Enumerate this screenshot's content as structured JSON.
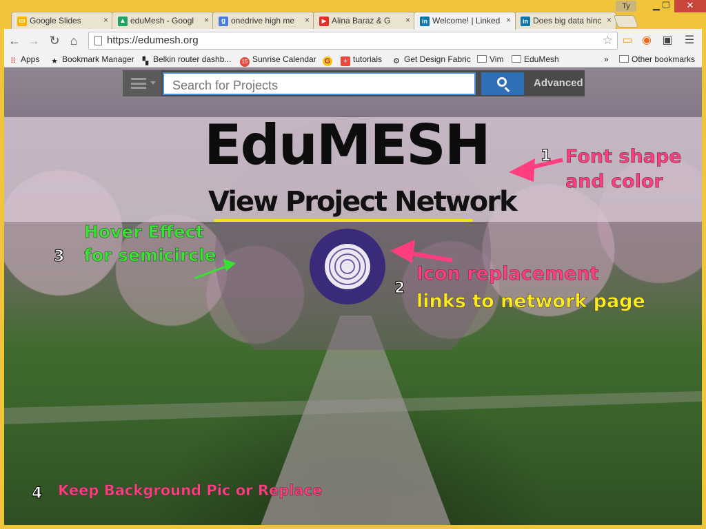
{
  "browser": {
    "tabs": [
      {
        "label": "Google Slides",
        "favicon": "slides-icon",
        "color": "#f4b400",
        "glyph": "▭"
      },
      {
        "label": "eduMesh - Googl",
        "favicon": "drive-icon",
        "color": "#1fa463",
        "glyph": "▲"
      },
      {
        "label": "onedrive high me",
        "favicon": "google-icon",
        "color": "#4a7bd8",
        "glyph": "g"
      },
      {
        "label": "Alina Baraz & G",
        "favicon": "youtube-icon",
        "color": "#e52d27",
        "glyph": "▶"
      },
      {
        "label": "Welcome! | Linked",
        "favicon": "linkedin-icon",
        "color": "#0e76a8",
        "glyph": "in"
      },
      {
        "label": "Does big data hinc",
        "favicon": "linkedin-icon",
        "color": "#0e76a8",
        "glyph": "in"
      }
    ],
    "close_glyph": "×",
    "user_badge": "Ty",
    "window_buttons": {
      "minimize": "▁",
      "maximize": "☐",
      "close": "✕"
    },
    "url": "https://edumesh.org",
    "bookmarks": [
      {
        "label": "Apps",
        "icon": "apps-grid-icon"
      },
      {
        "label": "Bookmark Manager",
        "icon": "star-icon"
      },
      {
        "label": "Belkin router dashb...",
        "icon": "belkin-icon"
      },
      {
        "label": "Sunrise Calendar",
        "icon": "sunrise-icon"
      },
      {
        "label": "",
        "icon": "g-circle-icon"
      },
      {
        "label": "tutorials",
        "icon": "plus-square-icon"
      },
      {
        "label": "Get Design Fabric",
        "icon": "gear-icon"
      },
      {
        "label": "Vim",
        "icon": "folder-icon"
      },
      {
        "label": "EduMesh",
        "icon": "folder-icon"
      }
    ],
    "bookmarks_overflow": "»",
    "other_bookmarks": "Other bookmarks"
  },
  "site": {
    "search_placeholder": "Search for Projects",
    "advanced_label": "Advanced",
    "brand": "EduMESH",
    "subtitle": "View Project Network",
    "accent_colors": {
      "underline": "#f4e21c",
      "icon_ring": "#3a2a7a",
      "search_button": "#2f6fb5"
    }
  },
  "annotations": [
    {
      "number": "1",
      "lines": [
        "Font shape",
        "and color"
      ],
      "color": "pink"
    },
    {
      "number": "2",
      "lines": [
        "Icon replacement",
        "links to network page"
      ],
      "color": "pink-yellow"
    },
    {
      "number": "3",
      "lines": [
        "Hover Effect",
        "for semicircle"
      ],
      "color": "green"
    },
    {
      "number": "4",
      "lines": [
        "Keep Background Pic or Replace"
      ],
      "color": "pink"
    }
  ]
}
